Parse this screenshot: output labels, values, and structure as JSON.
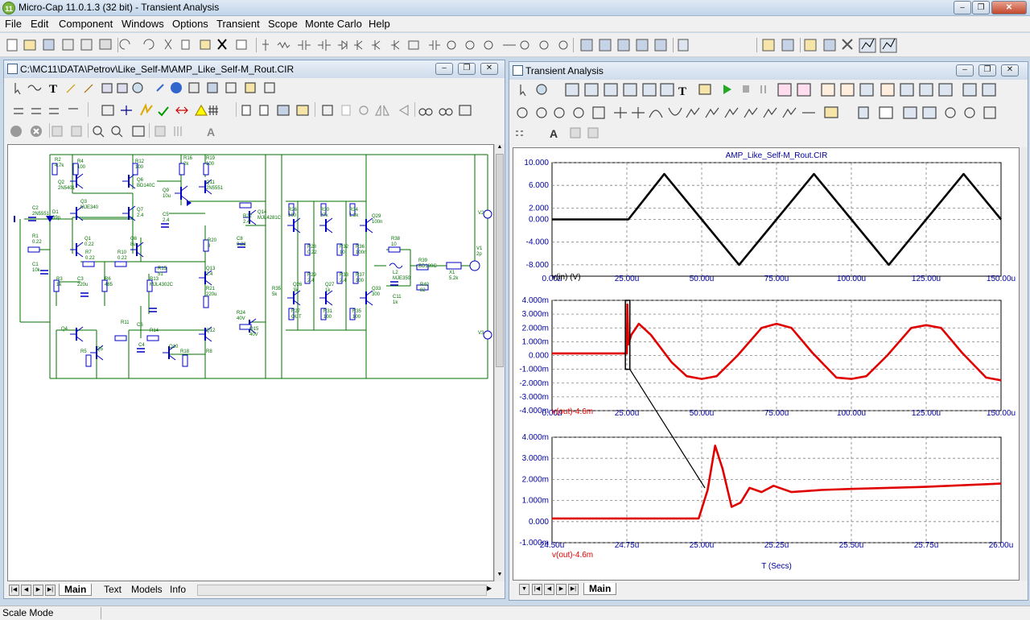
{
  "app": {
    "title": "Micro-Cap 11.0.1.3 (32 bit) - Transient Analysis",
    "icon_text": "11"
  },
  "menu": [
    "File",
    "Edit",
    "Component",
    "Windows",
    "Options",
    "Transient",
    "Scope",
    "Monte Carlo",
    "Help"
  ],
  "schematic": {
    "title": "C:\\MC11\\DATA\\Petrov\\Like_Self-M\\AMP_Like_Self-M_Rout.CIR",
    "tabs": [
      "Main",
      "Text",
      "Models",
      "Info"
    ],
    "components": [
      "R2",
      "R4",
      "R12",
      "R16",
      "R19",
      "Q2",
      "Q6",
      "Q9",
      "Q11",
      "C2",
      "D1",
      "Q3",
      "Q7",
      "C5",
      "R22",
      "Q14",
      "R26",
      "R30",
      "R34",
      "Q29",
      "R1",
      "R7",
      "R10",
      "Q1",
      "Q8",
      "R20",
      "C8",
      "R28",
      "R32",
      "R36",
      "R38",
      "V1",
      "C1",
      "R3",
      "C3",
      "R6",
      "R13",
      "R15",
      "Q13",
      "R29",
      "R33",
      "R37",
      "L2",
      "R39",
      "X1",
      "R35",
      "Q26",
      "Q27",
      "Q33",
      "C11",
      "R40",
      "R21",
      "R24",
      "Q15",
      "R27",
      "R31",
      "R35",
      "R11",
      "C6",
      "R14",
      "Q12",
      "Q4",
      "Q5",
      "C4",
      "Q10",
      "R18",
      "R5",
      "R8",
      "V2",
      "V3"
    ],
    "labels": [
      "4.7k",
      "100",
      "100",
      "2k",
      "100",
      "2N5401",
      "BD140C",
      "10u",
      "2N5551",
      "2N5551",
      "39p",
      "MJE340",
      "2.4",
      "2.4",
      "2.4",
      "MJL4281C",
      "100",
      "27k",
      "1.3k",
      "100n",
      "0.22",
      "0.22",
      "0.22",
      "0.22",
      "8u",
      "8",
      "0.22",
      "0.22",
      "10",
      "100n",
      "10",
      "2p",
      "10k",
      "1k",
      "220u",
      "485",
      "MJL4302C",
      "51",
      "2.4",
      "2.4",
      "2.4",
      "100",
      "MJE350",
      "BD139C",
      "5.2k",
      "5k",
      "3k",
      "1k",
      "300",
      "1k",
      "82",
      "220u",
      "40V",
      "40V",
      "OUT",
      "100",
      "100"
    ]
  },
  "analysis": {
    "title": "Transient Analysis",
    "tabs": [
      "Main"
    ],
    "plot_title": "AMP_Like_Self-M_Rout.CIR",
    "x_axis_label": "T (Secs)"
  },
  "status": {
    "mode": "Scale Mode"
  },
  "colors": {
    "trace1": "#000000",
    "trace2": "#e00000",
    "grid": "#808080",
    "schematic": "#007000"
  },
  "chart_data": [
    {
      "type": "line",
      "ylabel": "v(in) (V)",
      "xlim": [
        0,
        150
      ],
      "x_unit": "u",
      "ylim": [
        -10,
        10
      ],
      "x_ticks": [
        "0.00u",
        "25.00u",
        "50.00u",
        "75.00u",
        "100.00u",
        "125.00u",
        "150.00u"
      ],
      "y_ticks": [
        "10.000",
        "6.000",
        "2.000",
        "0.000",
        "-4.000",
        "-8.000"
      ],
      "series": [
        {
          "name": "v(in)",
          "x": [
            0,
            25,
            25.5,
            37.5,
            50,
            62.5,
            75,
            87.5,
            100,
            112.5,
            125,
            137.5,
            150
          ],
          "y": [
            0,
            0,
            0,
            8,
            0,
            -8,
            0,
            8,
            0,
            -8,
            0,
            8,
            0
          ]
        }
      ]
    },
    {
      "type": "line",
      "ylabel": "v(out)-4.6m",
      "xlim": [
        0,
        150
      ],
      "x_unit": "u",
      "ylim": [
        -4,
        4
      ],
      "x_ticks": [
        "0.00u",
        "25.00u",
        "50.00u",
        "75.00u",
        "100.00u",
        "125.00u",
        "150.00u"
      ],
      "y_ticks": [
        "4.000m",
        "3.000m",
        "2.000m",
        "1.000m",
        "0.000",
        "-1.000m",
        "-2.000m",
        "-3.000m",
        "-4.000m"
      ],
      "series": [
        {
          "name": "v(out)-4.6m",
          "x": [
            0,
            25,
            25.15,
            25.5,
            26.5,
            29,
            33,
            40,
            45,
            50,
            55,
            62,
            70,
            75,
            80,
            87,
            95,
            100,
            105,
            112,
            120,
            125,
            130,
            137,
            145,
            150
          ],
          "y": [
            0.15,
            0.15,
            3.7,
            0.8,
            1.5,
            2.3,
            1.5,
            -0.5,
            -1.5,
            -1.7,
            -1.5,
            0,
            2,
            2.3,
            2,
            0.2,
            -1.6,
            -1.7,
            -1.5,
            0,
            2,
            2.2,
            2,
            0.2,
            -1.6,
            -1.8
          ]
        }
      ]
    },
    {
      "type": "line",
      "ylabel": "v(out)-4.6m",
      "xlim": [
        24.5,
        26
      ],
      "x_unit": "u",
      "ylim": [
        -1,
        4
      ],
      "xlabel": "T (Secs)",
      "x_ticks": [
        "24.50u",
        "24.75u",
        "25.00u",
        "25.25u",
        "25.50u",
        "25.75u",
        "26.00u"
      ],
      "y_ticks": [
        "4.000m",
        "3.000m",
        "2.000m",
        "1.000m",
        "0.000",
        "-1.000m"
      ],
      "series": [
        {
          "name": "v(out)-4.6m",
          "x": [
            24.5,
            24.99,
            25.02,
            25.045,
            25.07,
            25.1,
            25.13,
            25.16,
            25.2,
            25.24,
            25.3,
            25.4,
            25.5,
            25.75,
            26
          ],
          "y": [
            0.15,
            0.15,
            1.5,
            3.6,
            2.5,
            0.7,
            0.9,
            1.6,
            1.4,
            1.7,
            1.4,
            1.5,
            1.55,
            1.65,
            1.8
          ]
        }
      ]
    }
  ]
}
